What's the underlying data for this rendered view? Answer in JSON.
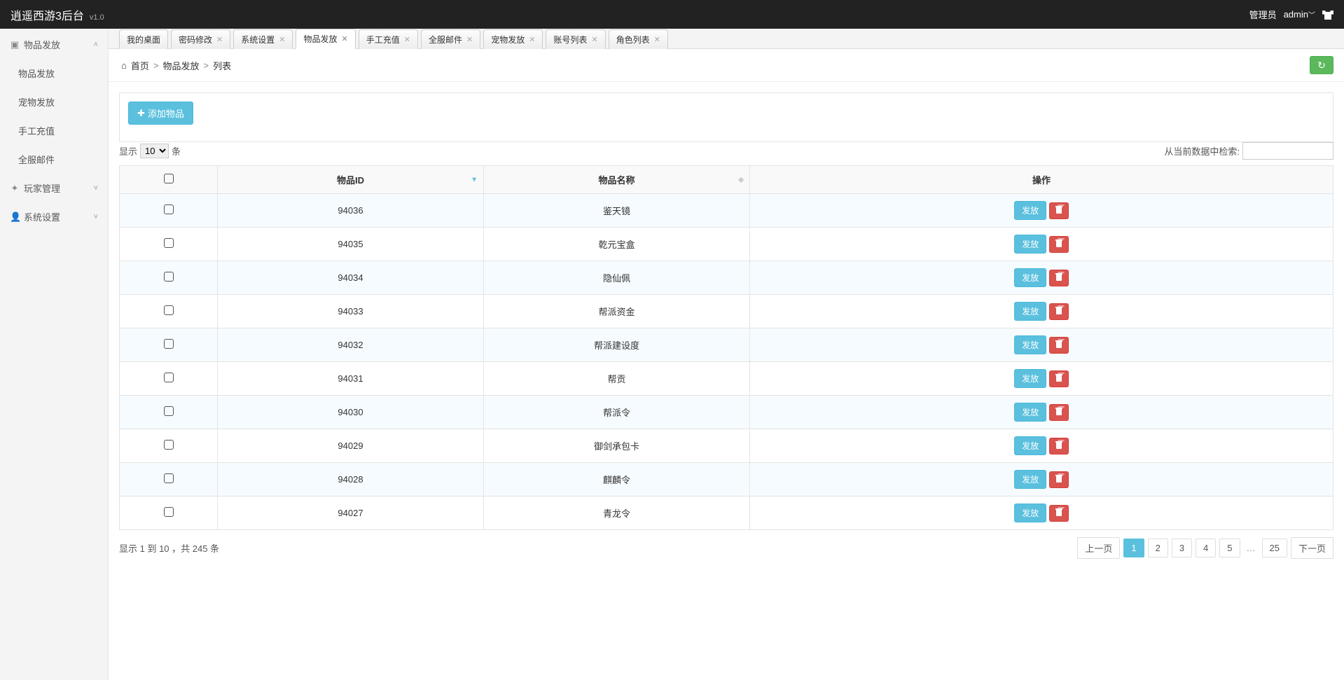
{
  "header": {
    "title": "逍遥西游3后台",
    "version": "v1.0",
    "user_role": "管理员",
    "user_name": "admin"
  },
  "sidebar": {
    "groups": [
      {
        "label": "物品发放",
        "icon": "monitor-icon",
        "expanded": true,
        "children": [
          {
            "label": "物品发放"
          },
          {
            "label": "宠物发放"
          },
          {
            "label": "手工充值"
          },
          {
            "label": "全服邮件"
          }
        ]
      },
      {
        "label": "玩家管理",
        "icon": "user-icon",
        "expanded": false
      },
      {
        "label": "系统设置",
        "icon": "person-icon",
        "expanded": false
      }
    ]
  },
  "tabs": [
    {
      "label": "我的桌面",
      "closable": false,
      "active": false
    },
    {
      "label": "密码修改",
      "closable": true,
      "active": false
    },
    {
      "label": "系统设置",
      "closable": true,
      "active": false
    },
    {
      "label": "物品发放",
      "closable": true,
      "active": true
    },
    {
      "label": "手工充值",
      "closable": true,
      "active": false
    },
    {
      "label": "全服邮件",
      "closable": true,
      "active": false
    },
    {
      "label": "宠物发放",
      "closable": true,
      "active": false
    },
    {
      "label": "账号列表",
      "closable": true,
      "active": false
    },
    {
      "label": "角色列表",
      "closable": true,
      "active": false
    }
  ],
  "breadcrumb": {
    "home": "首页",
    "mid": "物品发放",
    "leaf": "列表",
    "sep": ">"
  },
  "buttons": {
    "add": "添加物品",
    "issue": "发放",
    "refresh_title": "刷新"
  },
  "datatable": {
    "length_prefix": "显示",
    "length_value": "10",
    "length_suffix": "条",
    "search_label": "从当前数据中检索:",
    "search_value": "",
    "columns": {
      "chk": "",
      "id": "物品ID",
      "name": "物品名称",
      "ops": "操作"
    },
    "rows": [
      {
        "id": "94036",
        "name": "鉴天镜"
      },
      {
        "id": "94035",
        "name": "乾元宝盒"
      },
      {
        "id": "94034",
        "name": "隐仙佩"
      },
      {
        "id": "94033",
        "name": "帮派资金"
      },
      {
        "id": "94032",
        "name": "帮派建设度"
      },
      {
        "id": "94031",
        "name": "帮贡"
      },
      {
        "id": "94030",
        "name": "帮派令"
      },
      {
        "id": "94029",
        "name": "御剑承包卡"
      },
      {
        "id": "94028",
        "name": "麒麟令"
      },
      {
        "id": "94027",
        "name": "青龙令"
      }
    ],
    "info": "显示 1 到 10 ，共 245 条",
    "pager": {
      "prev": "上一页",
      "pages": [
        "1",
        "2",
        "3",
        "4",
        "5"
      ],
      "last": "25",
      "next": "下一页",
      "active": "1"
    }
  }
}
